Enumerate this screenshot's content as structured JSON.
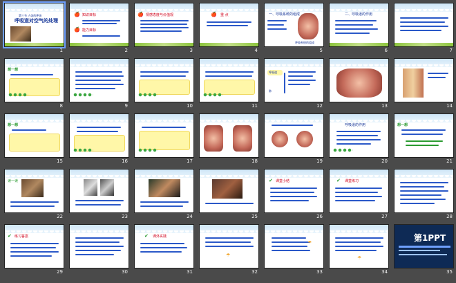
{
  "slides": [
    {
      "num": "1",
      "title": "呼吸道对空气的处理",
      "tag": "第三节 人体的呼吸"
    },
    {
      "num": "2",
      "title": "知识目标",
      "title2": "能力目标"
    },
    {
      "num": "3",
      "title": "情感态度与价值观"
    },
    {
      "num": "4",
      "title": "重 点"
    },
    {
      "num": "5",
      "title": "一、呼吸系统的组成",
      "caption": "呼吸系统的组成"
    },
    {
      "num": "6",
      "title": "二、呼吸道的作用"
    },
    {
      "num": "7"
    },
    {
      "num": "8",
      "title": "想一想"
    },
    {
      "num": "9"
    },
    {
      "num": "10"
    },
    {
      "num": "11"
    },
    {
      "num": "12",
      "title": "呼吸道",
      "title2": "肺"
    },
    {
      "num": "13"
    },
    {
      "num": "14"
    },
    {
      "num": "15",
      "title": "想一想"
    },
    {
      "num": "16"
    },
    {
      "num": "17"
    },
    {
      "num": "18"
    },
    {
      "num": "19"
    },
    {
      "num": "20",
      "title": "呼吸道的作用"
    },
    {
      "num": "21",
      "title": "想一想"
    },
    {
      "num": "22",
      "title": "读一读"
    },
    {
      "num": "23"
    },
    {
      "num": "24"
    },
    {
      "num": "25"
    },
    {
      "num": "26",
      "title": "课堂小结"
    },
    {
      "num": "27",
      "title": "课堂练习"
    },
    {
      "num": "28"
    },
    {
      "num": "29",
      "title": "练习答案"
    },
    {
      "num": "30"
    },
    {
      "num": "31",
      "title": "课外实践"
    },
    {
      "num": "32"
    },
    {
      "num": "33"
    },
    {
      "num": "34"
    },
    {
      "num": "35",
      "logo": "第1PPT"
    }
  ]
}
